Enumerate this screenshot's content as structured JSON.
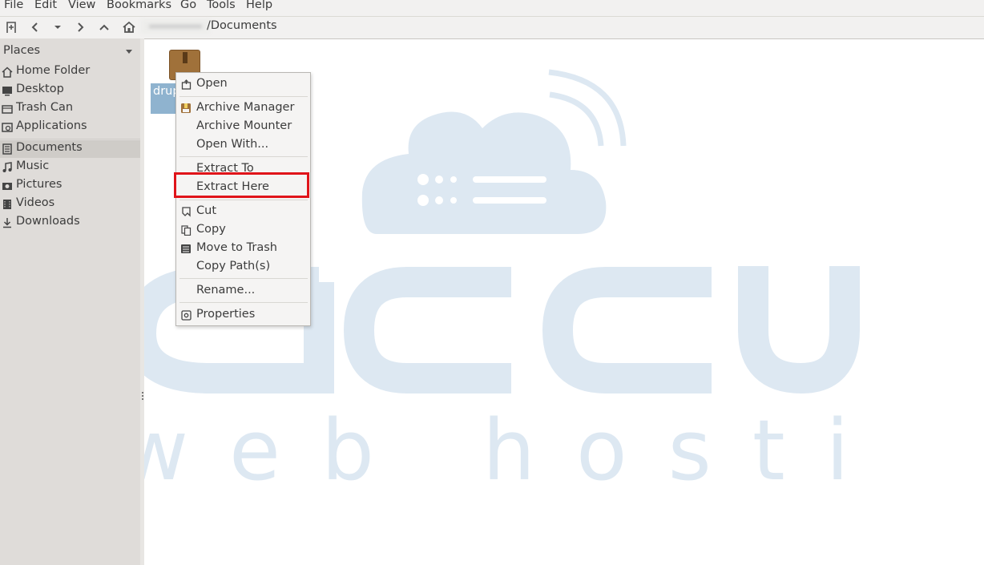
{
  "menubar": {
    "items": [
      "File",
      "Edit",
      "View",
      "Bookmarks",
      "Go",
      "Tools",
      "Help"
    ]
  },
  "toolbar": {
    "buttons": [
      "new-tab-icon",
      "back-icon",
      "history-dropdown-icon",
      "forward-icon",
      "up-icon",
      "home-icon"
    ],
    "path_current": "/Documents"
  },
  "sidebar": {
    "header": "Places",
    "items": [
      {
        "label": "Home Folder",
        "icon": "home-icon"
      },
      {
        "label": "Desktop",
        "icon": "desktop-icon"
      },
      {
        "label": "Trash Can",
        "icon": "trash-icon"
      },
      {
        "label": "Applications",
        "icon": "applications-icon"
      },
      {
        "label": "Documents",
        "icon": "documents-icon",
        "active": true
      },
      {
        "label": "Music",
        "icon": "music-icon"
      },
      {
        "label": "Pictures",
        "icon": "pictures-icon"
      },
      {
        "label": "Videos",
        "icon": "videos-icon"
      },
      {
        "label": "Downloads",
        "icon": "downloads-icon"
      }
    ]
  },
  "file": {
    "label_visible": "drup"
  },
  "context_menu": {
    "items": [
      {
        "label": "Open",
        "icon": "open-icon"
      },
      {
        "label": "Archive Manager",
        "icon": "archive-manager-icon"
      },
      {
        "label": "Archive Mounter"
      },
      {
        "label": "Open With..."
      },
      {
        "label": "Extract To"
      },
      {
        "label": "Extract Here",
        "highlighted": true
      },
      {
        "label": "Cut",
        "icon": "cut-icon"
      },
      {
        "label": "Copy",
        "icon": "copy-icon"
      },
      {
        "label": "Move to Trash",
        "icon": "trash-icon"
      },
      {
        "label": "Copy Path(s)"
      },
      {
        "label": "Rename..."
      },
      {
        "label": "Properties",
        "icon": "properties-icon"
      }
    ]
  },
  "watermark": {
    "brand": "accu",
    "tagline": "web hosting",
    "color": "#dde8f2"
  },
  "colors": {
    "highlight_box": "#e0141a",
    "selection": "#8fb3cf",
    "sidebar_bg": "#dfdcd9"
  }
}
